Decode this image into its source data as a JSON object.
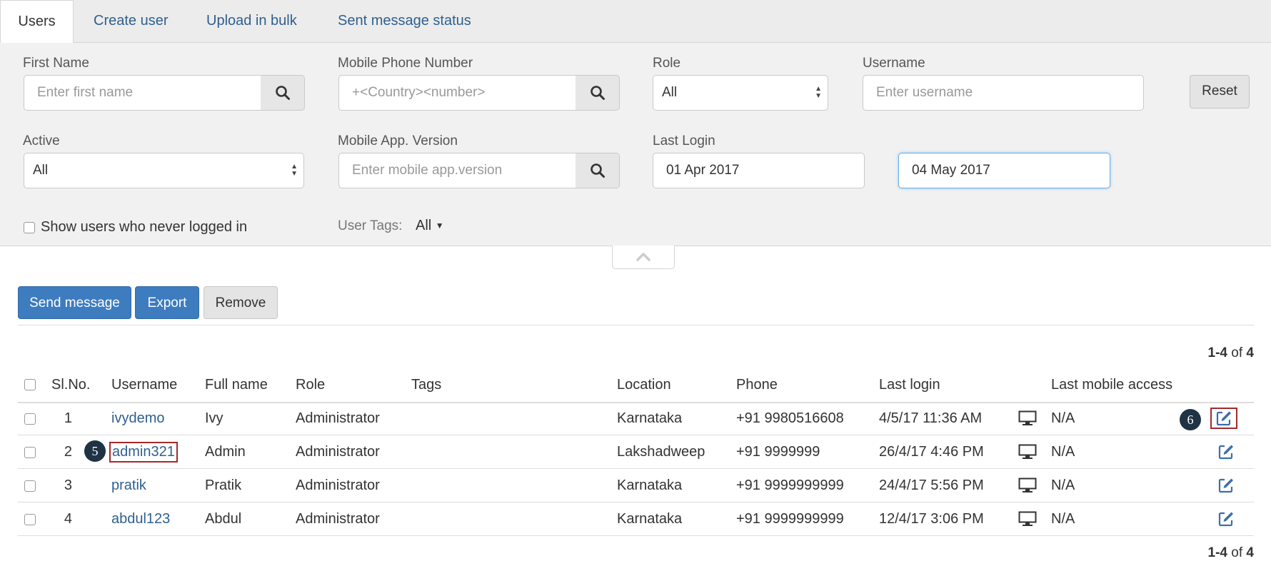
{
  "tabs": [
    {
      "label": "Users",
      "active": true
    },
    {
      "label": "Create user"
    },
    {
      "label": "Upload in bulk"
    },
    {
      "label": "Sent message status"
    }
  ],
  "filters": {
    "first_name": {
      "label": "First Name",
      "placeholder": "Enter first name"
    },
    "mobile_phone": {
      "label": "Mobile Phone Number",
      "placeholder": "+<Country><number>"
    },
    "role": {
      "label": "Role",
      "value": "All"
    },
    "username": {
      "label": "Username",
      "placeholder": "Enter username"
    },
    "reset_label": "Reset",
    "active": {
      "label": "Active",
      "value": "All"
    },
    "app_version": {
      "label": "Mobile App. Version",
      "placeholder": "Enter mobile app.version"
    },
    "last_login": {
      "label": "Last Login",
      "from": "01 Apr 2017",
      "to": "04 May 2017"
    },
    "never_logged_in_label": "Show users who never logged in",
    "user_tags": {
      "label": "User Tags:",
      "value": "All"
    }
  },
  "actions": {
    "send_message": "Send message",
    "export": "Export",
    "remove": "Remove"
  },
  "pagination": {
    "range": "1-4",
    "of_label": "of",
    "total": "4"
  },
  "table": {
    "headers": {
      "sl_no": "Sl.No.",
      "username": "Username",
      "full_name": "Full name",
      "role": "Role",
      "tags": "Tags",
      "location": "Location",
      "phone": "Phone",
      "last_login": "Last login",
      "last_mobile_access": "Last mobile access"
    },
    "rows": [
      {
        "sl": "1",
        "username": "ivydemo",
        "full_name": "Ivy",
        "role": "Administrator",
        "tags": "",
        "location": "Karnataka",
        "phone": "+91 9980516608",
        "last_login": "4/5/17 11:36 AM",
        "last_mobile_access": "N/A"
      },
      {
        "sl": "2",
        "username": "admin321",
        "full_name": "Admin",
        "role": "Administrator",
        "tags": "",
        "location": "Lakshadweep",
        "phone": "+91 9999999",
        "last_login": "26/4/17 4:46 PM",
        "last_mobile_access": "N/A"
      },
      {
        "sl": "3",
        "username": "pratik",
        "full_name": "Pratik",
        "role": "Administrator",
        "tags": "",
        "location": "Karnataka",
        "phone": "+91 9999999999",
        "last_login": "24/4/17 5:56 PM",
        "last_mobile_access": "N/A"
      },
      {
        "sl": "4",
        "username": "abdul123",
        "full_name": "Abdul",
        "role": "Administrator",
        "tags": "",
        "location": "Karnataka",
        "phone": "+91 9999999999",
        "last_login": "12/4/17 3:06 PM",
        "last_mobile_access": "N/A"
      }
    ]
  },
  "callouts": {
    "username_marker": "5",
    "edit_marker": "6"
  },
  "icons": {
    "search": "search-icon",
    "collapse": "chevron-up-icon",
    "device": "desktop-monitor-icon",
    "edit": "edit-icon",
    "caret": "caret-down-icon",
    "select_arrows": "select-arrows-icon"
  },
  "colors": {
    "primary": "#3d7cbf",
    "link": "#2f5f8f",
    "highlight": "#a52a2a",
    "callout": "#1f3344",
    "focus": "#66afe9"
  }
}
